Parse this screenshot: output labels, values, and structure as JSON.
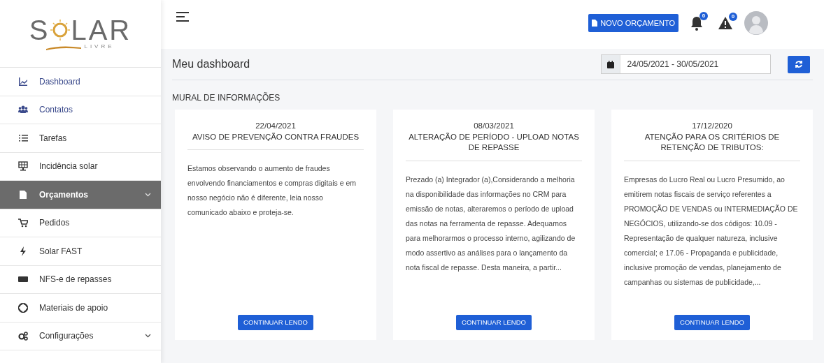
{
  "logo": {
    "left": "S",
    "right": "LAR",
    "tagline": "LIVRE"
  },
  "sidebar": {
    "items": [
      {
        "label": "Dashboard",
        "selected": false,
        "expandable": false,
        "color": "#3c4b8c"
      },
      {
        "label": "Contatos",
        "selected": false,
        "expandable": false,
        "color": "#3c4b8c"
      },
      {
        "label": "Tarefas",
        "selected": false,
        "expandable": false,
        "color": "#333333"
      },
      {
        "label": "Incidência solar",
        "selected": false,
        "expandable": false,
        "color": "#333333"
      },
      {
        "label": "Orçamentos",
        "selected": true,
        "expandable": true
      },
      {
        "label": "Pedidos",
        "selected": false,
        "expandable": false,
        "color": "#333333"
      },
      {
        "label": "Solar FAST",
        "selected": false,
        "expandable": false,
        "color": "#333333"
      },
      {
        "label": "NFS-e de repasses",
        "selected": false,
        "expandable": false,
        "color": "#333333"
      },
      {
        "label": "Materiais de apoio",
        "selected": false,
        "expandable": false,
        "color": "#333333"
      },
      {
        "label": "Configurações",
        "selected": false,
        "expandable": true,
        "color": "#333333"
      }
    ]
  },
  "topbar": {
    "new_button": "NOVO ORÇAMENTO",
    "notifications_count": "0",
    "alerts_count": "0"
  },
  "page_title": "Meu dashboard",
  "date_range": {
    "value": "24/05/2021 - 30/05/2021"
  },
  "section_title": "MURAL DE INFORMAÇÕES",
  "cards": [
    {
      "date": "22/04/2021",
      "title": "AVISO DE PREVENÇÃO CONTRA FRAUDES",
      "body": "Estamos observando o aumento de fraudes envolvendo financiamentos e compras digitais e em nosso negócio não é diferente, leia nosso comunicado abaixo e proteja-se.",
      "button": "CONTINUAR LENDO"
    },
    {
      "date": "08/03/2021",
      "title": "ALTERAÇÃO DE PERÍODO - UPLOAD NOTAS DE REPASSE",
      "body": "Prezado (a) Integrador (a),Considerando a melhoria na disponibilidade das informações no CRM para emissão de notas, alteraremos o período de upload das notas na ferramenta de repasse. Adequamos para melhorarmos o processo interno, agilizando de modo assertivo as análises para o lançamento da nota fiscal de repasse. Desta maneira, a partir...",
      "button": "CONTINUAR LENDO"
    },
    {
      "date": "17/12/2020",
      "title": "ATENÇÃO PARA OS CRITÉRIOS DE RETENÇÃO DE TRIBUTOS:",
      "body": "Empresas do Lucro Real ou Lucro Presumido, ao emitirem notas fiscais de serviço referentes a PROMOÇÃO DE VENDAS ou INTERMEDIAÇÃO DE NEGÓCIOS, utilizando-se dos códigos: 10.09 - Representação de qualquer natureza, inclusive comercial; e 17.06 - Propaganda e publicidade, inclusive promoção de vendas, planejamento de campanhas ou sistemas de publicidade,...",
      "button": "CONTINUAR LENDO"
    }
  ]
}
